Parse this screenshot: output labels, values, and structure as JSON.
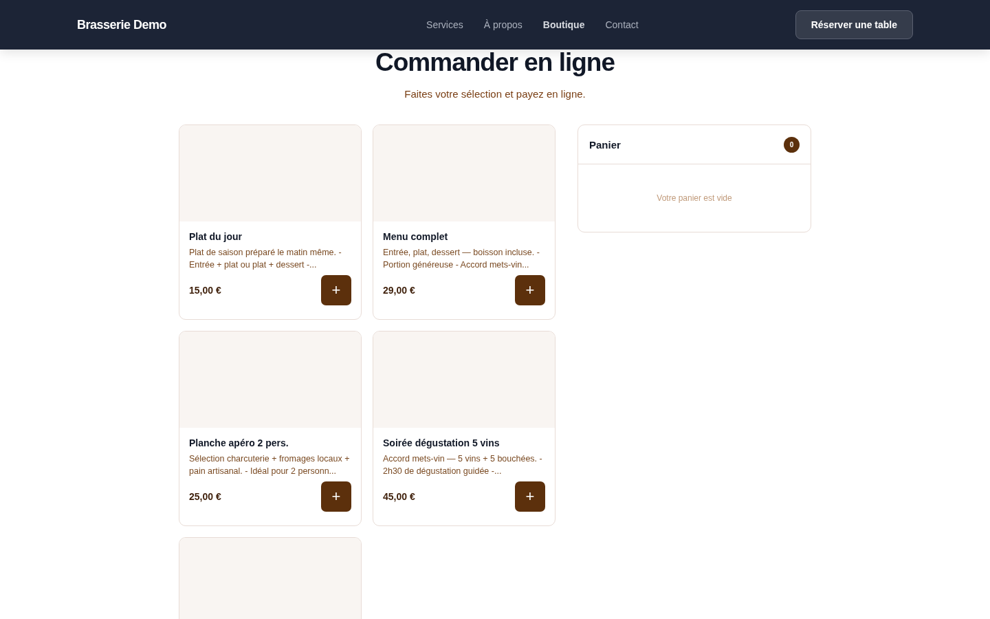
{
  "header": {
    "brand": "Brasserie Demo",
    "nav": [
      {
        "label": "Services",
        "selected": false
      },
      {
        "label": "À propos",
        "selected": false
      },
      {
        "label": "Boutique",
        "selected": true
      },
      {
        "label": "Contact",
        "selected": false
      }
    ],
    "cta": "Réserver une table"
  },
  "page": {
    "title": "Commander en ligne",
    "subtitle": "Faites votre sélection et payez en ligne."
  },
  "products": [
    {
      "kind": "full",
      "name": "Plat du jour",
      "description": "Plat de saison préparé le matin même. - Entrée + plat ou plat + dessert -...",
      "price": "15,00 €",
      "add": "+"
    },
    {
      "kind": "full",
      "name": "Menu complet",
      "description": "Entrée, plat, dessert — boisson incluse. - Portion généreuse - Accord mets-vin...",
      "price": "29,00 €",
      "add": "+"
    },
    {
      "kind": "full",
      "name": "Planche apéro 2 pers.",
      "description": "Sélection charcuterie + fromages locaux + pain artisanal. - Idéal pour 2 personn...",
      "price": "25,00 €",
      "add": "+"
    },
    {
      "kind": "full",
      "name": "Soirée dégustation 5 vins",
      "description": "Accord mets-vin — 5 vins + 5 bouchées. - 2h30 de dégustation guidée -...",
      "price": "45,00 €",
      "add": "+"
    },
    {
      "kind": "cut"
    }
  ],
  "cart": {
    "title": "Panier",
    "count": "0",
    "empty": "Votre panier est vide"
  }
}
